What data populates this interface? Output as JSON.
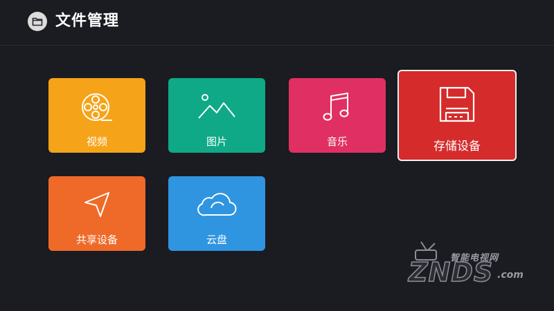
{
  "app": {
    "title": "文件管理",
    "title_icon": "folder-icon"
  },
  "tiles": [
    {
      "id": "video",
      "label": "视频",
      "icon": "film-reel-icon",
      "color": "#f5a318"
    },
    {
      "id": "photo",
      "label": "图片",
      "icon": "mountain-icon",
      "color": "#0fa987"
    },
    {
      "id": "music",
      "label": "音乐",
      "icon": "music-note-icon",
      "color": "#e03063"
    },
    {
      "id": "storage",
      "label": "存储设备",
      "icon": "floppy-disk-icon",
      "color": "#d52b2b",
      "focused": true
    },
    {
      "id": "share",
      "label": "共享设备",
      "icon": "navigation-arrow-icon",
      "color": "#ef6a28"
    },
    {
      "id": "cloud",
      "label": "云盘",
      "icon": "cloud-icon",
      "color": "#2f95e0"
    }
  ],
  "watermark": {
    "cn_text": "智能电视网",
    "logo_text": "ZNDS",
    "domain_suffix": ".com"
  },
  "colors": {
    "background": "#1b1b22",
    "focus_border": "#f2f2f2"
  }
}
